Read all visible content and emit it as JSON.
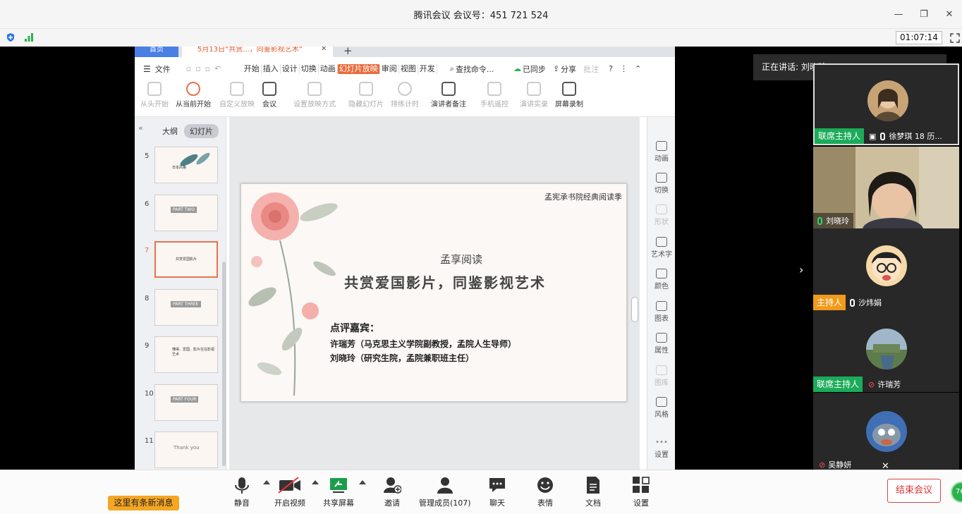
{
  "window": {
    "title": "腾讯会议 会议号：451 721 524",
    "timer": "01:07:14"
  },
  "share": {
    "tabs": {
      "home": "首页",
      "doc": "5月13日“共赏...，同鉴影视艺术”"
    },
    "menu": {
      "file": "文件",
      "items": [
        "开始",
        "插入",
        "设计",
        "切换",
        "动画",
        "幻灯片放映",
        "审阅",
        "视图",
        "开发"
      ],
      "active": "幻灯片放映",
      "search": "查找命令...",
      "sync": "已同步",
      "share": "分享",
      "comment": "批注"
    },
    "ribbon": [
      "从头开始",
      "从当前开始",
      "自定义放映",
      "会议",
      "设置放映方式",
      "隐藏幻灯片",
      "排练计时",
      "演讲者备注",
      "手机遥控",
      "演讲实录",
      "屏幕录制"
    ],
    "left_tabs": {
      "outline": "大纲",
      "slides": "幻灯片"
    },
    "thumbnails": [
      {
        "num": "5",
        "text": "日本风格"
      },
      {
        "num": "6",
        "text": "PART TWO"
      },
      {
        "num": "7",
        "text": "共赏爱国影片"
      },
      {
        "num": "8",
        "text": "PART THREE"
      },
      {
        "num": "9",
        "text": "懂得、爱国、影片在在影视艺术"
      },
      {
        "num": "10",
        "text": "PART FOUR"
      },
      {
        "num": "11",
        "text": "Thank you"
      }
    ],
    "slide": {
      "org": "孟宪承书院经典阅读季",
      "series": "孟享阅读",
      "title": "共赏爱国影片，同鉴影视艺术",
      "guest_label": "点评嘉宾：",
      "guest1": "许瑞芳（马克思主义学院副教授，孟院人生导师）",
      "guest2": "刘晓玲（研究生院，孟院兼职班主任）"
    },
    "right_tools": [
      "动画",
      "切换",
      "形状",
      "艺术字",
      "颜色",
      "图表",
      "属性",
      "图库",
      "风格",
      "设置"
    ]
  },
  "speaker": {
    "text": "正在讲话: 刘晓玲;"
  },
  "participants": [
    {
      "badge": "联席主持人",
      "name": "徐梦琪 18 历...",
      "badge_color": "#1bab5a"
    },
    {
      "badge": "",
      "name": "刘晓玲",
      "badge_color": ""
    },
    {
      "badge": "主持人",
      "name": "沙炜娟",
      "badge_color": "#f29a1c"
    },
    {
      "badge": "联席主持人",
      "name": "许瑞芳",
      "badge_color": "#1bab5a"
    },
    {
      "badge": "",
      "name": "吴静妍",
      "badge_color": ""
    }
  ],
  "toolbar": {
    "mute": "静音",
    "video": "开启视频",
    "screen": "共享屏幕",
    "invite": "邀请",
    "members": "管理成员(107)",
    "chat": "聊天",
    "emoji": "表情",
    "docs": "文档",
    "settings": "设置",
    "end": "结束会议",
    "notice": "这里有条新消息",
    "corner": "76"
  }
}
